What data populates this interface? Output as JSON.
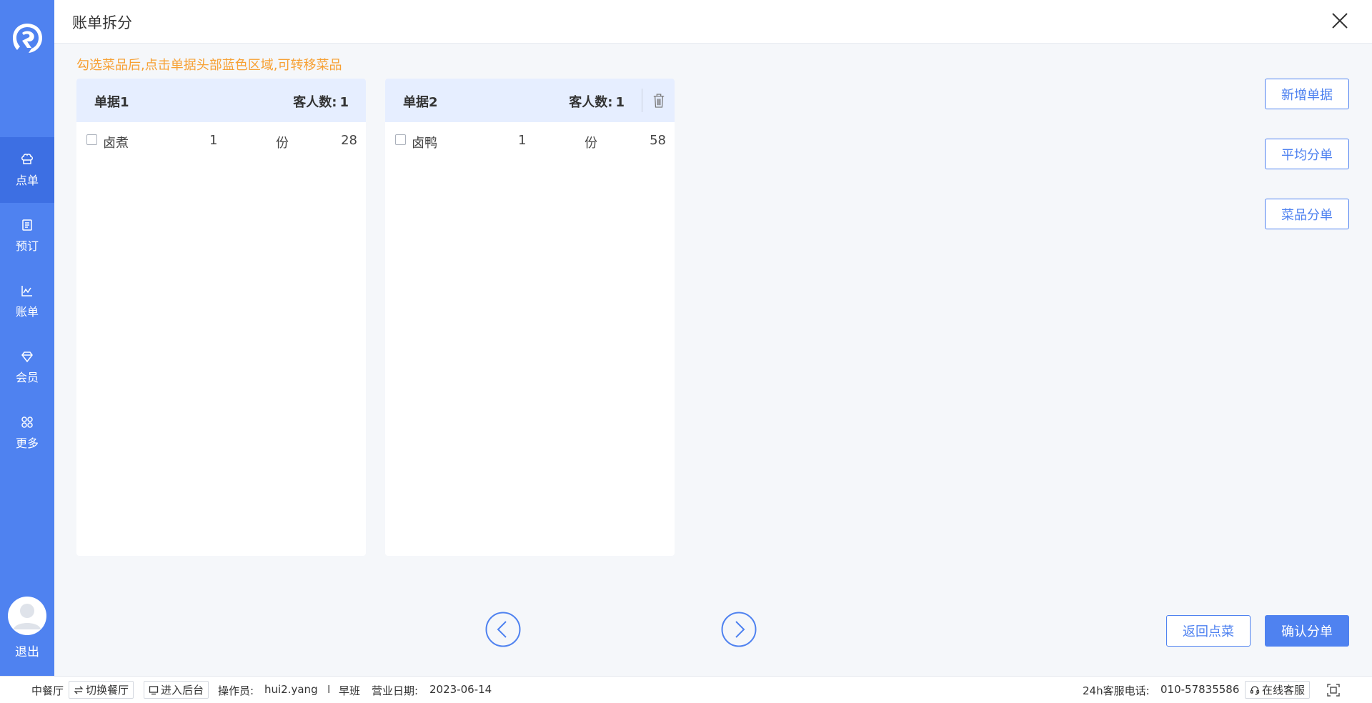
{
  "header": {
    "title": "账单拆分"
  },
  "hint": "勾选菜品后,点击单据头部蓝色区域,可转移菜品",
  "sidebar": {
    "items": [
      {
        "label": "点单",
        "icon": "chef-hat-icon"
      },
      {
        "label": "预订",
        "icon": "book-icon"
      },
      {
        "label": "账单",
        "icon": "chart-icon"
      },
      {
        "label": "会员",
        "icon": "diamond-icon"
      },
      {
        "label": "更多",
        "icon": "grid-icon"
      }
    ],
    "active_index": 0,
    "logout_label": "退出"
  },
  "bills": [
    {
      "name": "单据1",
      "guest_label": "客人数:",
      "guest_count": "1",
      "dishes": [
        {
          "name": "卤煮",
          "qty": "1",
          "unit": "份",
          "price": "28",
          "checked": false
        }
      ]
    },
    {
      "name": "单据2",
      "guest_label": "客人数:",
      "guest_count": "1",
      "dishes": [
        {
          "name": "卤鸭",
          "qty": "1",
          "unit": "份",
          "price": "58",
          "checked": false
        }
      ]
    }
  ],
  "actions": {
    "add_bill": "新增单据",
    "avg_split": "平均分单",
    "dish_split": "菜品分单",
    "back": "返回点菜",
    "confirm": "确认分单"
  },
  "footer": {
    "hall": "中餐厅",
    "switch_hall": "切换餐厅",
    "backend": "进入后台",
    "operator_label": "操作员:",
    "operator": "hui2.yang",
    "separator": "I",
    "shift": "早班",
    "date_label": "营业日期:",
    "date": "2023-06-14",
    "hotline_label": "24h客服电话:",
    "hotline": "010-57835586",
    "online_service": "在线客服"
  },
  "colors": {
    "primary": "#4f82f0",
    "hint": "#f7a033",
    "card_header": "#e6eeff"
  }
}
